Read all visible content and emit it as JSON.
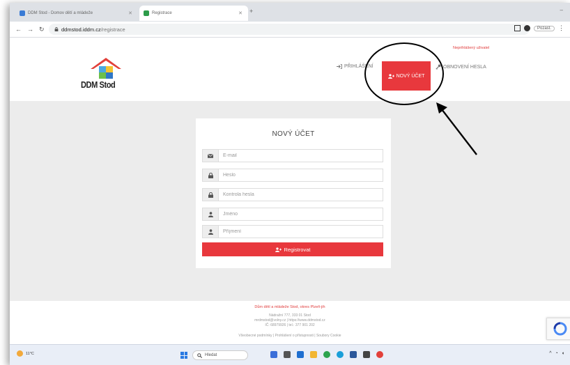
{
  "browser": {
    "tab1_title": "DDM Stod - Domov dětí a mládeže",
    "tab2_title": "Registrace",
    "url_domain": "ddmstod.iddm.cz",
    "url_path": "/registrace",
    "pause_label": "Pozast."
  },
  "header": {
    "reg_note": "Neprihlášený uživatel",
    "logo_text": "DDM Stod",
    "nav": {
      "login": "PŘIHLÁŠENÍ",
      "new_account": "NOVÝ ÚČET",
      "reset": "OBNOVENÍ HESLA"
    }
  },
  "form": {
    "title": "NOVÝ ÚČET",
    "email_placeholder": "E-mail",
    "password_placeholder": "Heslo",
    "password_check_placeholder": "Kontrola hesla",
    "firstname_placeholder": "Jméno",
    "lastname_placeholder": "Příjmení",
    "submit_label": "Registrovat"
  },
  "footer": {
    "title": "Dům dětí a mládeže Stod, okres Plzeň-jih",
    "line1": "Nádražní 777, 333 01 Stod",
    "line2": "mrdmstod@volny.cz | https://www.ddmstod.cz",
    "line3": "IČ: 68979926 | tel.: 377 901 202",
    "line4": "Všeobecné podmínky | Prohlášení o přístupnosti | Soubory Cookie"
  },
  "taskbar": {
    "temperature": "11°C",
    "search_label": "Hledat"
  },
  "colors": {
    "accent": "#e8383d",
    "page_bg": "#ececec"
  }
}
